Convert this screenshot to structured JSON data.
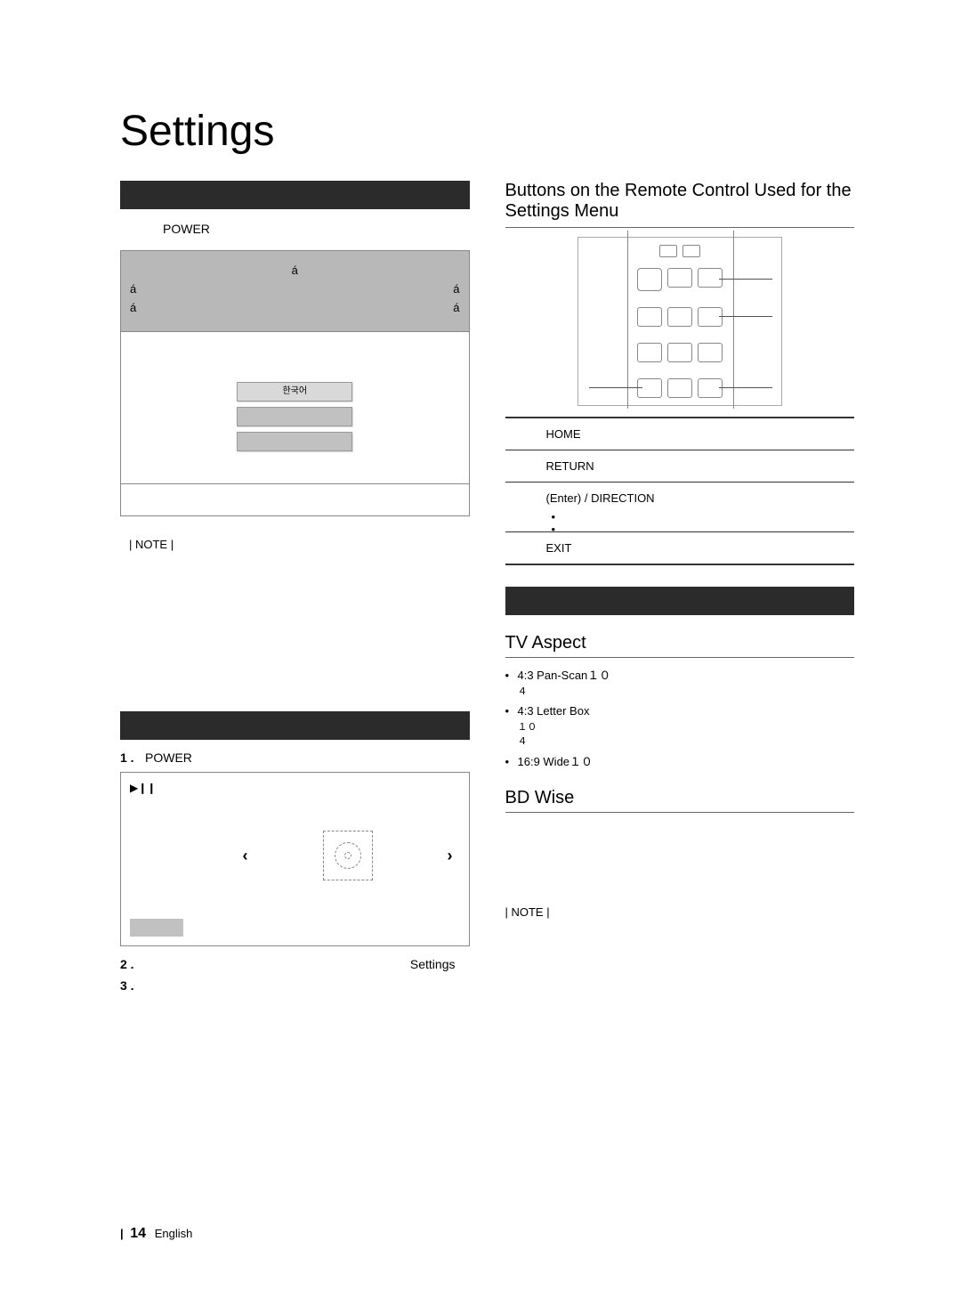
{
  "title": "Settings",
  "left": {
    "power": "POWER",
    "option_selected": "한국어",
    "note": "| NOTE |"
  },
  "right_section_title": "Buttons on the Remote Control Used for the Settings Menu",
  "button_table": [
    {
      "label": "HOME"
    },
    {
      "label": "RETURN"
    },
    {
      "label": "(Enter) / DIRECTION",
      "sub": [
        "",
        ""
      ]
    },
    {
      "label": "EXIT"
    }
  ],
  "tv_aspect": {
    "title": "TV Aspect",
    "items": [
      {
        "main": "4:3 Pan-Scan",
        "suffix": "１０",
        "sub": "４"
      },
      {
        "main": "4:3 Letter Box",
        "suffix": "",
        "sub1": "１０",
        "sub2": "４"
      },
      {
        "main": "16:9 Wide",
        "suffix": "１０"
      }
    ]
  },
  "bd_wise": {
    "title": "BD Wise",
    "note": "| NOTE |"
  },
  "start_steps": {
    "step1_word": "POWER",
    "step2_word": "Settings"
  },
  "footer": {
    "page": "14",
    "lang": "English"
  }
}
